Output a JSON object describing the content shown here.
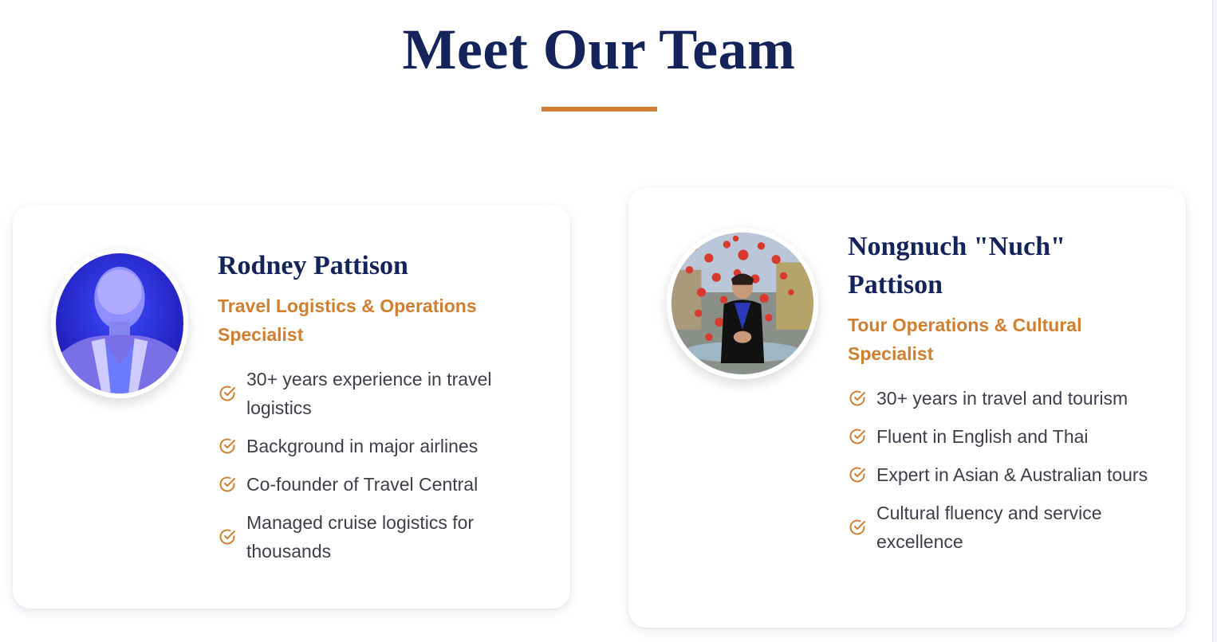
{
  "section": {
    "title": "Meet Our Team"
  },
  "colors": {
    "navy": "#14235a",
    "accent": "#cf7f2f",
    "text": "#3c3f4a"
  },
  "team": [
    {
      "name": "Rodney Pattison",
      "role": "Travel Logistics & Operations Specialist",
      "photo_icon": "portrait-photo",
      "highlights": [
        "30+ years experience in travel logistics",
        "Background in major airlines",
        "Co-founder of Travel Central",
        "Managed cruise logistics for thousands"
      ]
    },
    {
      "name": "Nongnuch \"Nuch\" Pattison",
      "role": "Tour Operations & Cultural Specialist",
      "photo_icon": "portrait-photo",
      "highlights": [
        "30+ years in travel and tourism",
        "Fluent in English and Thai",
        "Expert in Asian & Australian tours",
        "Cultural fluency and service excellence"
      ]
    }
  ]
}
